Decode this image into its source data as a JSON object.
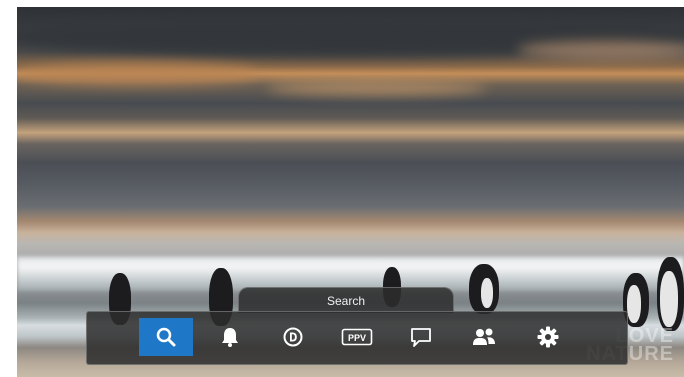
{
  "menu": {
    "active_label": "Search",
    "items": [
      {
        "id": "search",
        "icon": "search-icon",
        "selected": true
      },
      {
        "id": "reminders",
        "icon": "bell-icon",
        "selected": false
      },
      {
        "id": "on-demand",
        "icon": "d-circle-icon",
        "selected": false
      },
      {
        "id": "ppv",
        "icon": "ppv-icon",
        "text": "PPV",
        "selected": false
      },
      {
        "id": "messages",
        "icon": "speech-bubble-icon",
        "selected": false
      },
      {
        "id": "profiles",
        "icon": "people-icon",
        "selected": false
      },
      {
        "id": "settings",
        "icon": "gear-icon",
        "selected": false
      }
    ]
  },
  "watermark": {
    "line1": "LOVE",
    "line2": "NATURE"
  },
  "colors": {
    "selected": "#1f77c7",
    "bar": "#2d2d2d"
  }
}
